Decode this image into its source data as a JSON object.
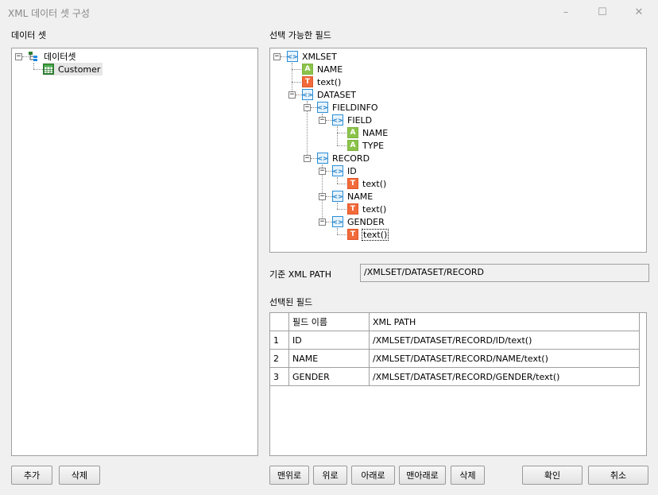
{
  "window": {
    "title": "XML 데이터 셋 구성",
    "minimize": "–",
    "maximize": "☐",
    "close": "✕"
  },
  "left": {
    "label": "데이터 셋",
    "tree": {
      "root": "데이터셋",
      "child": "Customer"
    },
    "add_button": "추가",
    "delete_button": "삭제"
  },
  "fields": {
    "label": "선택 가능한 필드",
    "nodes": [
      {
        "type": "element",
        "label": "XMLSET",
        "expand": "−"
      },
      {
        "type": "attribute",
        "label": "NAME"
      },
      {
        "type": "text",
        "label": "text()"
      },
      {
        "type": "element",
        "label": "DATASET",
        "expand": "−"
      },
      {
        "type": "element",
        "label": "FIELDINFO",
        "expand": "−"
      },
      {
        "type": "element",
        "label": "FIELD",
        "expand": "−"
      },
      {
        "type": "attribute",
        "label": "NAME"
      },
      {
        "type": "attribute",
        "label": "TYPE"
      },
      {
        "type": "element",
        "label": "RECORD",
        "expand": "−"
      },
      {
        "type": "element",
        "label": "ID",
        "expand": "−"
      },
      {
        "type": "text",
        "label": "text()"
      },
      {
        "type": "element",
        "label": "NAME",
        "expand": "−"
      },
      {
        "type": "text",
        "label": "text()"
      },
      {
        "type": "element",
        "label": "GENDER",
        "expand": "−"
      },
      {
        "type": "text",
        "label": "text()"
      }
    ],
    "icons": {
      "element": "<>",
      "attribute": "A",
      "text": "T"
    }
  },
  "base_path": {
    "label": "기준 XML PATH",
    "value": "/XMLSET/DATASET/RECORD"
  },
  "selected": {
    "label": "선택된 필드",
    "columns": [
      "",
      "필드 이름",
      "XML PATH"
    ],
    "rows": [
      {
        "num": "1",
        "name": "ID",
        "path": "/XMLSET/DATASET/RECORD/ID/text()"
      },
      {
        "num": "2",
        "name": "NAME",
        "path": "/XMLSET/DATASET/RECORD/NAME/text()"
      },
      {
        "num": "3",
        "name": "GENDER",
        "path": "/XMLSET/DATASET/RECORD/GENDER/text()"
      }
    ]
  },
  "buttons": {
    "top": "맨위로",
    "up": "위로",
    "down": "아래로",
    "bottom": "맨아래로",
    "delete": "삭제",
    "ok": "확인",
    "cancel": "취소"
  }
}
